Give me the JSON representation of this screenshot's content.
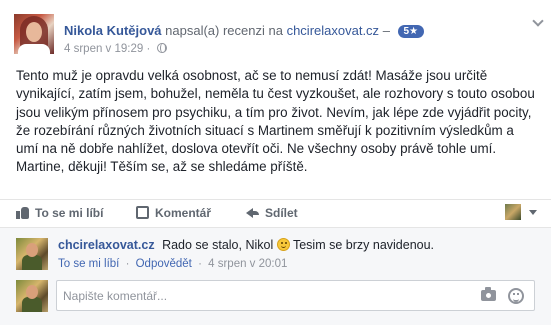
{
  "review": {
    "author_name": "Nikola Kutějová",
    "action_text": "napsal(a) recenzi na",
    "site_name": "chcirelaxovat.cz",
    "dash": "–",
    "rating_badge": "5★",
    "timestamp": "4 srpen v 19:29",
    "visibility_icon": "globe-icon",
    "body": "Tento muž je opravdu velká osobnost, ač se to nemusí zdát! Masáže jsou určitě vynikající, zatím jsem, bohužel, neměla tu čest vyzkoušet, ale rozhovory s touto osobou jsou velikým přínosem pro psychiku, a tím pro život. Nevím, jak lépe zde vyjádřit pocity, že rozebírání různých životních situací s Martinem směřují k pozitivním výsledkům a umí na ně dobře nahlížet, doslova otevřít oči. Ne všechny osoby právě tohle umí. Martine, děkuji! Těším se, až se shledáme příště."
  },
  "actions": {
    "like_label": "To se mi líbí",
    "comment_label": "Komentář",
    "share_label": "Sdílet"
  },
  "comments": [
    {
      "author": "chcirelaxovat.cz",
      "text": "Rado se stalo, Nikol",
      "text_after": "Tesim se brzy navidenou.",
      "like_label": "To se mi líbí",
      "reply_label": "Odpovědět",
      "timestamp": "4 srpen v 20:01",
      "separator": "·"
    }
  ],
  "composer": {
    "placeholder": "Napište komentář..."
  },
  "colors": {
    "link": "#365899",
    "badge": "#4267b2",
    "muted": "#90949c",
    "comments_bg": "#f6f7f9"
  }
}
